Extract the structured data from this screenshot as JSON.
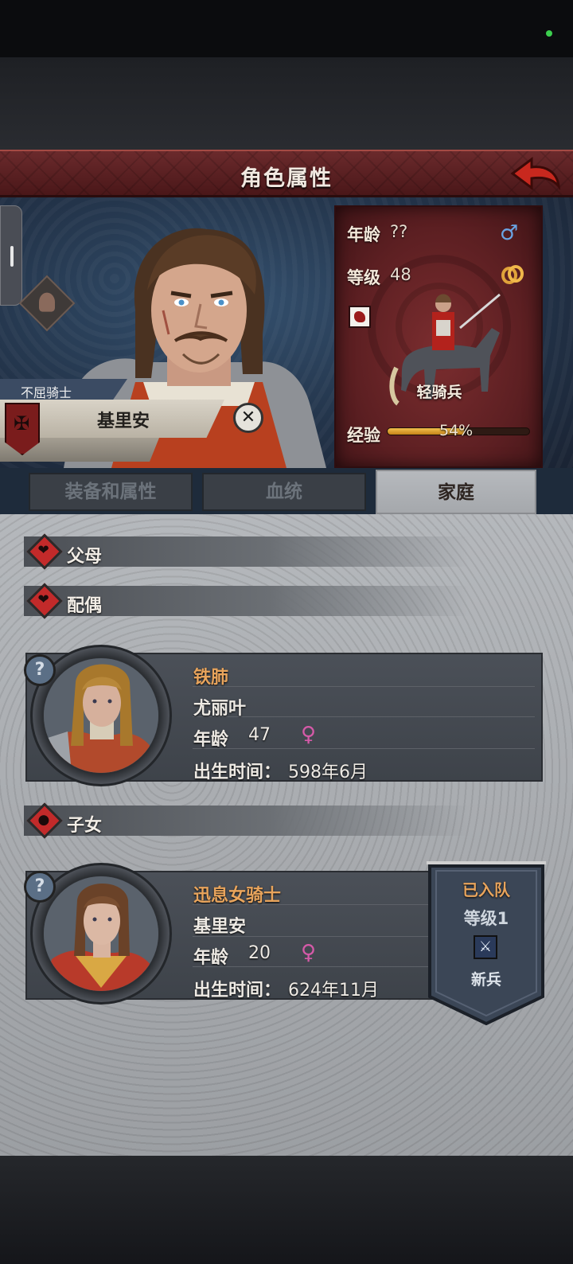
{
  "header": {
    "title": "角色属性"
  },
  "character": {
    "title": "不屈骑士",
    "name": "基里安"
  },
  "stats": {
    "age_label": "年龄",
    "age_value": "??",
    "level_label": "等级",
    "level_value": "48",
    "unit_name": "轻骑兵",
    "exp_label": "经验",
    "exp_percent_text": "54%",
    "exp_progress": 0.54
  },
  "tabs": [
    {
      "label": "装备和属性"
    },
    {
      "label": "血统"
    },
    {
      "label": "家庭"
    }
  ],
  "sections": {
    "parents": "父母",
    "spouse": "配偶",
    "children": "子女"
  },
  "spouse_card": {
    "title": "铁肺",
    "name": "尤丽叶",
    "age_label": "年龄",
    "age_value": "47",
    "birth_label": "出生时间：",
    "birth_value": "598年6月"
  },
  "child_card": {
    "title": "迅息女骑士",
    "name": "基里安",
    "age_label": "年龄",
    "age_value": "20",
    "birth_label": "出生时间：",
    "birth_value": "624年11月"
  },
  "child_banner": {
    "status": "已入队",
    "level": "等级1",
    "rank": "新兵"
  },
  "colors": {
    "header_red": "#5c1f22",
    "accent_orange": "#e8a45c",
    "male_blue": "#6aa4e4",
    "female_pink": "#d55aa8"
  },
  "icons": [
    "back-arrow-icon",
    "close-icon",
    "male-icon",
    "ring-icon",
    "female-icon",
    "heart-icon",
    "child-icon",
    "question-icon",
    "sword-icon"
  ]
}
